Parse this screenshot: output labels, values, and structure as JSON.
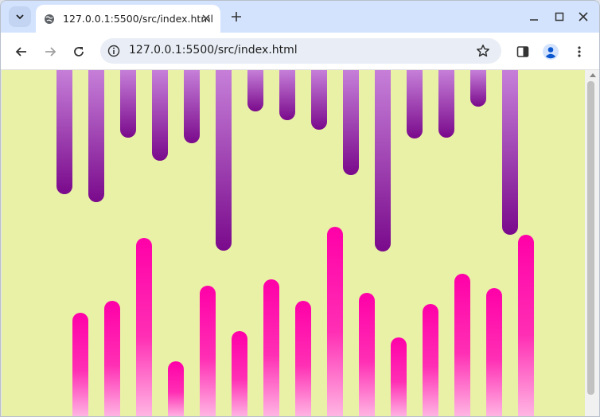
{
  "browser": {
    "tab": {
      "title": "127.0.0.1:5500/src/index.html"
    },
    "omnibox": {
      "url": "127.0.0.1:5500/src/index.html"
    },
    "icons": {
      "tab_search": "chevron-down-icon",
      "favicon": "globe-icon",
      "tab_close": "close-icon",
      "new_tab": "plus-icon",
      "minimize": "minimize-icon",
      "maximize": "maximize-icon",
      "close_window": "close-icon",
      "back": "arrow-left-icon",
      "forward": "arrow-right-icon",
      "reload": "reload-icon",
      "site_info": "info-icon",
      "bookmark": "star-icon",
      "side_panel": "side-panel-icon",
      "profile": "profile-icon",
      "menu": "kebab-menu-icon"
    }
  },
  "page": {
    "background_color": "#e9f1a6",
    "top_bar_colors": [
      "#c67fd9",
      "#7a0a8c"
    ],
    "bottom_bar_colors": [
      "#ff00a8",
      "#ffb8e4"
    ],
    "top_bar_lengths": [
      156,
      166,
      85,
      114,
      92,
      227,
      52,
      63,
      75,
      132,
      228,
      86,
      85,
      46,
      207
    ],
    "bottom_bar_lengths": [
      132,
      147,
      226,
      71,
      166,
      109,
      174,
      147,
      240,
      157,
      101,
      143,
      181,
      163,
      230
    ]
  }
}
